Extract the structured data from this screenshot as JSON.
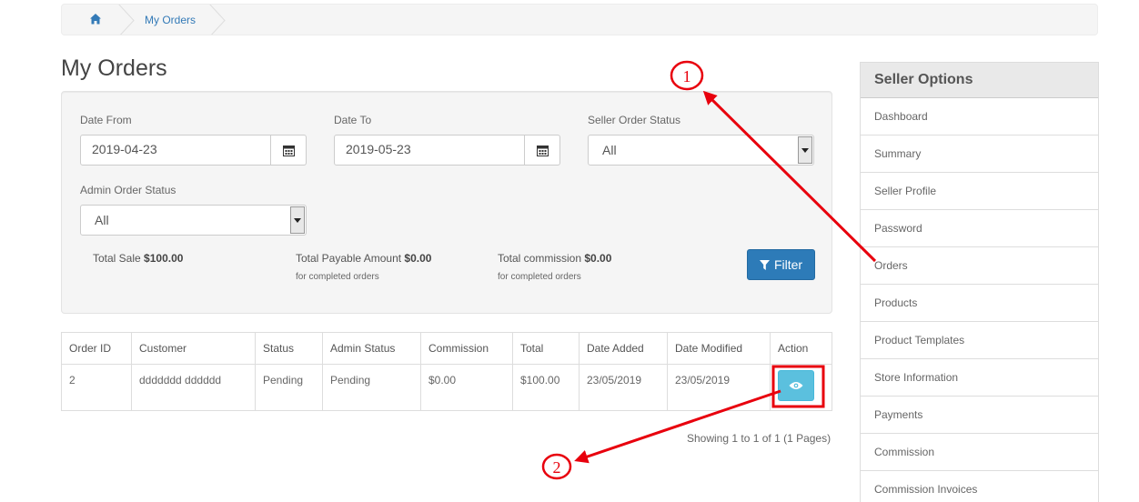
{
  "breadcrumb": {
    "home_icon": "home-icon",
    "current": "My Orders"
  },
  "page": {
    "title": "My Orders"
  },
  "filters": {
    "date_from_label": "Date From",
    "date_from_value": "2019-04-23",
    "date_to_label": "Date To",
    "date_to_value": "2019-05-23",
    "seller_status_label": "Seller Order Status",
    "seller_status_value": "All",
    "admin_status_label": "Admin Order Status",
    "admin_status_value": "All",
    "filter_button": "Filter"
  },
  "totals": {
    "sale_label": "Total Sale",
    "sale_value": "$100.00",
    "payable_label": "Total Payable Amount",
    "payable_value": "$0.00",
    "payable_note": "for completed orders",
    "commission_label": "Total commission",
    "commission_value": "$0.00",
    "commission_note": "for completed orders"
  },
  "table": {
    "headers": [
      "Order ID",
      "Customer",
      "Status",
      "Admin Status",
      "Commission",
      "Total",
      "Date Added",
      "Date Modified",
      "Action"
    ],
    "rows": [
      {
        "order_id": "2",
        "customer": "ddddddd dddddd",
        "status": "Pending",
        "admin_status": "Pending",
        "commission": "$0.00",
        "total": "$100.00",
        "date_added": "23/05/2019",
        "date_modified": "23/05/2019",
        "action_icon": "eye-icon"
      }
    ]
  },
  "pagination": {
    "text": "Showing 1 to 1 of 1 (1 Pages)"
  },
  "sidebar": {
    "title": "Seller Options",
    "items": [
      "Dashboard",
      "Summary",
      "Seller Profile",
      "Password",
      "Orders",
      "Products",
      "Product Templates",
      "Store Information",
      "Payments",
      "Commission",
      "Commission Invoices"
    ]
  },
  "annotations": {
    "marker_1": "1",
    "marker_2": "2",
    "color": "#e8000d"
  },
  "colors": {
    "primary_button": "#2d7bb8",
    "info_button": "#5bc0de",
    "link": "#337ab7"
  }
}
